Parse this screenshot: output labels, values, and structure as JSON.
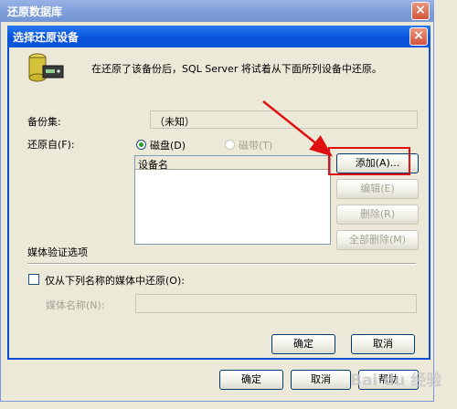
{
  "background_window": {
    "title": "还原数据库",
    "close_glyph": "×",
    "ok_label": "确定",
    "cancel_label": "取消",
    "help_label": "帮助"
  },
  "dialog": {
    "title": "选择还原设备",
    "close_glyph": "×",
    "info_text": "在还原了该备份后，SQL Server 将试着从下面所列设备中还原。",
    "backup_set_label": "备份集:",
    "backup_set_value": "（未知）",
    "restore_from_label": "还原自(F):",
    "radio_disk_label": "磁盘(D)",
    "radio_tape_label": "磁带(T)",
    "device_column_header": "设备名",
    "devices": [],
    "add_button": "添加(A)...",
    "edit_button": "编辑(E)",
    "remove_button": "删除(R)",
    "remove_all_button": "全部删除(M)",
    "media_verify_label": "媒体验证选项",
    "only_named_media_label": "仅从下列名称的媒体中还原(O):",
    "media_name_label": "媒体名称(N):",
    "media_name_value": "",
    "ok_button": "确定",
    "cancel_button": "取消"
  },
  "watermark_text": "Bai du 经验",
  "annotation_color": "#e01010"
}
